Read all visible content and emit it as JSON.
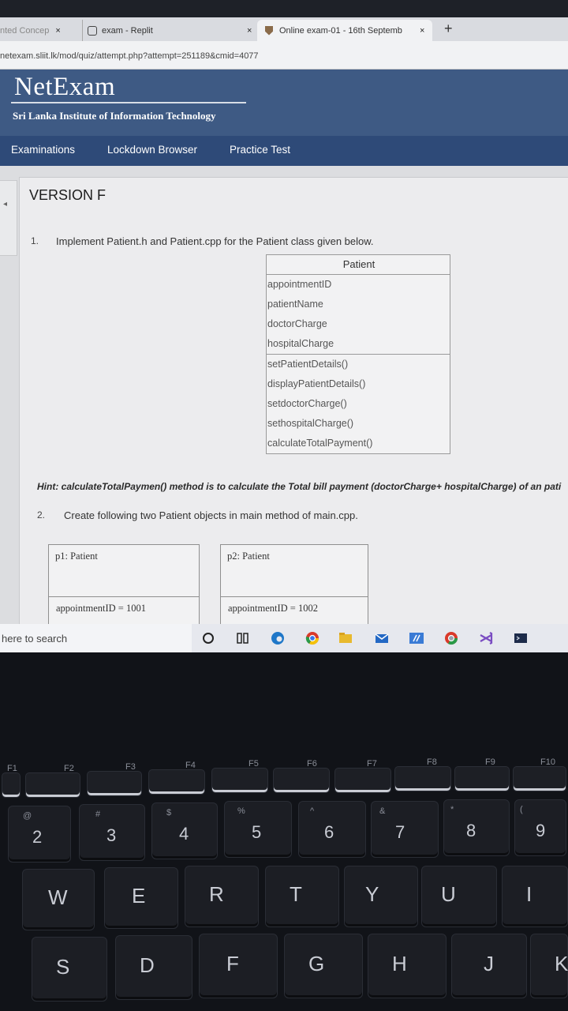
{
  "browser": {
    "tabs": [
      {
        "title": "nted Concep",
        "close": "×"
      },
      {
        "title": "exam - Replit",
        "close": "×"
      },
      {
        "title": "Online exam-01 - 16th Septemb",
        "close": "×"
      }
    ],
    "new_tab": "+",
    "url": "netexam.sliit.lk/mod/quiz/attempt.php?attempt=251189&cmid=4077"
  },
  "site": {
    "brand": "NetExam",
    "tagline": "Sri Lanka Institute of Information Technology",
    "nav": [
      "Examinations",
      "Lockdown Browser",
      "Practice Test"
    ]
  },
  "quiz": {
    "version": "VERSION F",
    "q1_num": "1.",
    "q1_text": "Implement Patient.h and Patient.cpp for the Patient class given below.",
    "class_name": "Patient",
    "attributes": [
      "appointmentID",
      "patientName",
      "doctorCharge",
      "hospitalCharge"
    ],
    "methods": [
      "setPatientDetails()",
      "displayPatientDetails()",
      "setdoctorCharge()",
      "sethospitalCharge()",
      "calculateTotalPayment()"
    ],
    "hint": "Hint:  calculateTotalPaymen() method is to calculate the Total bill payment (doctorCharge+ hospitalCharge) of an pati",
    "q2_num": "2.",
    "q2_text": "Create following two Patient objects in main method of main.cpp.",
    "objects": [
      {
        "title": "p1: Patient",
        "field": "appointmentID = 1001"
      },
      {
        "title": "p2: Patient",
        "field": "appointmentID = 1002"
      }
    ]
  },
  "taskbar": {
    "search": "here to search"
  },
  "keyboard": {
    "fkeys": [
      "F1",
      "F2",
      "F3",
      "F4",
      "F5",
      "F6",
      "F7",
      "F8",
      "F9",
      "F10"
    ],
    "num_row": [
      "2",
      "3",
      "4",
      "5",
      "6",
      "7",
      "8",
      "9"
    ],
    "num_shift": [
      "@",
      "#",
      "$",
      "%",
      "^",
      "&",
      "*",
      "("
    ],
    "row_q": [
      "W",
      "E",
      "R",
      "T",
      "Y",
      "U",
      "I"
    ],
    "row_a": [
      "S",
      "D",
      "F",
      "G",
      "H",
      "J",
      "K"
    ]
  },
  "colors": {
    "header": "#3e5a84",
    "nav": "#2e4a78",
    "page": "#ececee"
  }
}
